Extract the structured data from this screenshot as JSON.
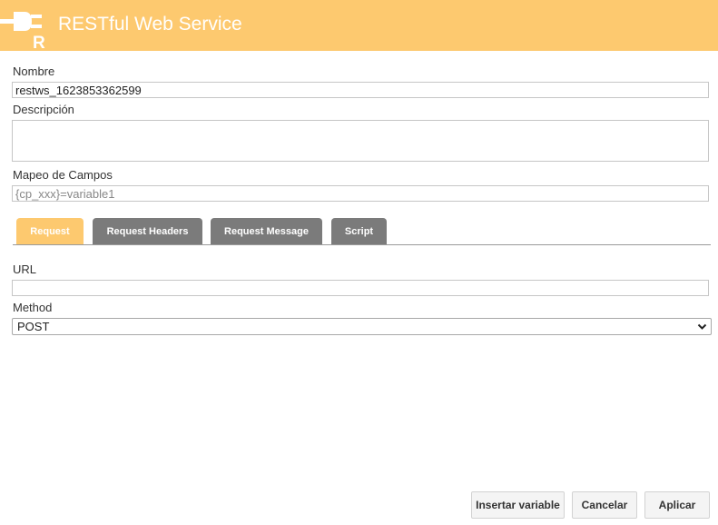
{
  "header": {
    "title": "RESTful Web Service",
    "logo_letter": "R",
    "logo_icon": "plug-icon",
    "background_color": "#fdc96f"
  },
  "form": {
    "nombre": {
      "label": "Nombre",
      "value": "restws_1623853362599"
    },
    "descripcion": {
      "label": "Descripción",
      "value": ""
    },
    "mapeo": {
      "label": "Mapeo de Campos",
      "placeholder": "{cp_xxx}=variable1",
      "value": ""
    }
  },
  "tabs": [
    {
      "label": "Request",
      "active": true
    },
    {
      "label": "Request Headers",
      "active": false
    },
    {
      "label": "Request Message",
      "active": false
    },
    {
      "label": "Script",
      "active": false
    }
  ],
  "request": {
    "url": {
      "label": "URL",
      "value": ""
    },
    "method": {
      "label": "Method",
      "selected": "POST"
    }
  },
  "buttons": {
    "insert_variable": "Insertar variable",
    "cancel": "Cancelar",
    "apply": "Aplicar"
  },
  "colors": {
    "accent": "#fdc96f",
    "tab_inactive": "#7b7b7b"
  }
}
